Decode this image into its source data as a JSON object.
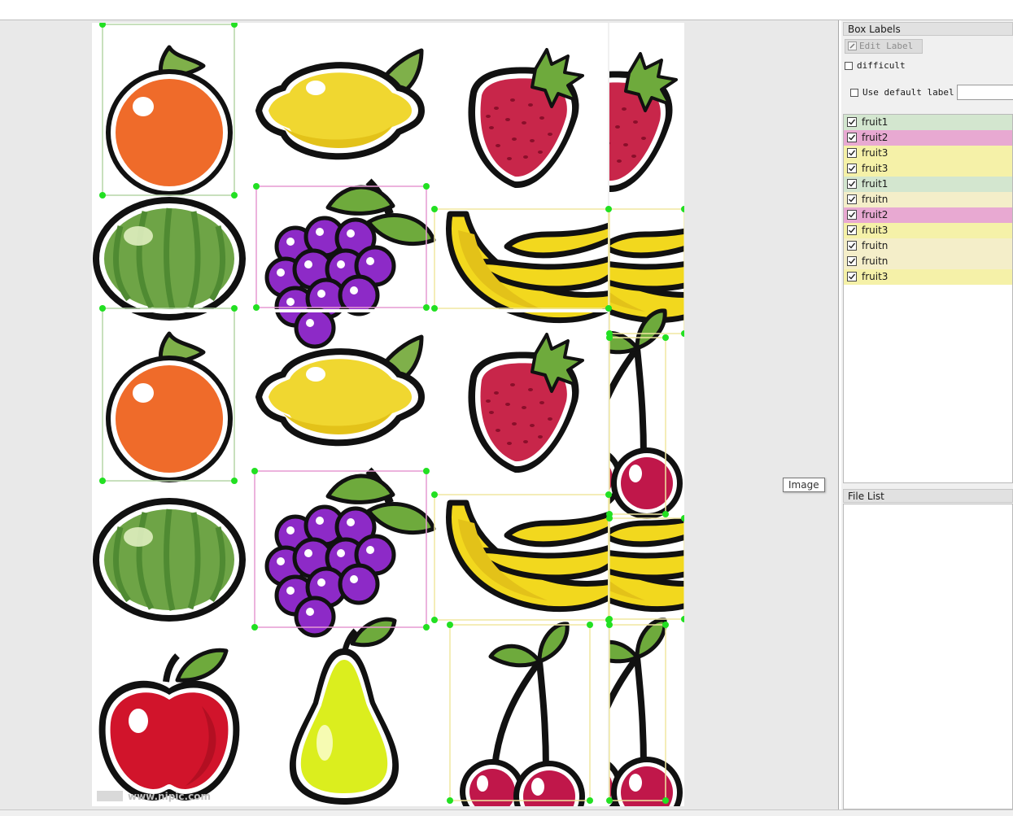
{
  "canvas": {
    "tooltip": "Image",
    "watermark": "www.nipic.com",
    "background": "#e9e9e9"
  },
  "box_labels_panel": {
    "title": "Box Labels",
    "edit_label_button": "Edit Label",
    "difficult_label": "difficult",
    "use_default_label": "Use default label",
    "default_label_value": "",
    "labels": [
      {
        "name": "fruit1",
        "checked": true,
        "color": "#d3e6cf"
      },
      {
        "name": "fruit2",
        "checked": true,
        "color": "#e8a9d2"
      },
      {
        "name": "fruit3",
        "checked": true,
        "color": "#f5f1a8"
      },
      {
        "name": "fruit3",
        "checked": true,
        "color": "#f5f1a8"
      },
      {
        "name": "fruit1",
        "checked": true,
        "color": "#d3e6cf"
      },
      {
        "name": "fruitn",
        "checked": true,
        "color": "#f4eec9"
      },
      {
        "name": "fruit2",
        "checked": true,
        "color": "#e8a9d2"
      },
      {
        "name": "fruit3",
        "checked": true,
        "color": "#f5f1a8"
      },
      {
        "name": "fruitn",
        "checked": true,
        "color": "#f4eec9"
      },
      {
        "name": "fruitn",
        "checked": true,
        "color": "#f4eec9"
      },
      {
        "name": "fruit3",
        "checked": true,
        "color": "#f5f1a8"
      }
    ]
  },
  "file_list_panel": {
    "title": "File List"
  },
  "colors": {
    "handle": "#22e022",
    "box_fruit1": "#b5d6a7",
    "box_fruit2": "#e59ad2",
    "box_fruit3": "#f0e7a0"
  }
}
